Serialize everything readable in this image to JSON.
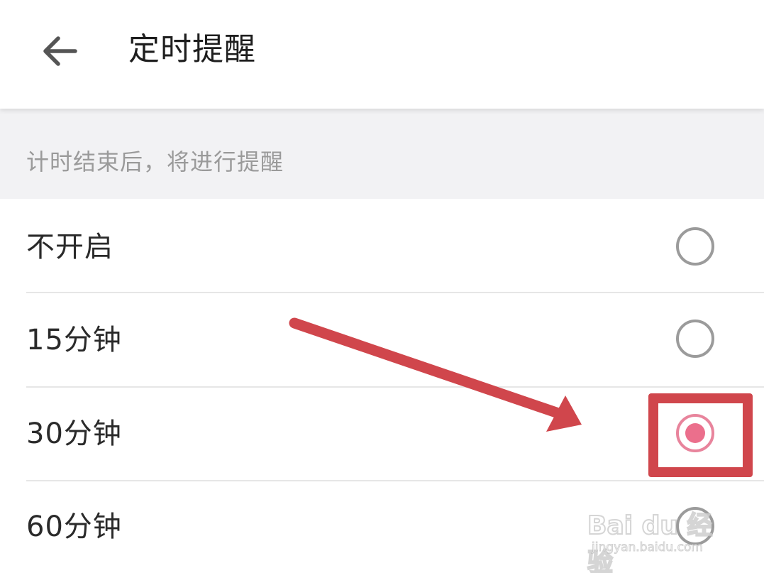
{
  "header": {
    "back_icon": "arrow-left-icon",
    "title": "定时提醒"
  },
  "section": {
    "description": "计时结束后，将进行提醒"
  },
  "options": [
    {
      "label": "不开启",
      "selected": false
    },
    {
      "label": "15分钟",
      "selected": false
    },
    {
      "label": "30分钟",
      "selected": true
    },
    {
      "label": "60分钟",
      "selected": false
    }
  ],
  "colors": {
    "accent": "#eb6f8c",
    "annotation": "#d0464c",
    "section_bg": "#f2f2f4",
    "radio_border": "#9b9b9b"
  },
  "watermark": {
    "logo_text": "Bai du 经验",
    "url": "jingyan.baidu.com"
  }
}
